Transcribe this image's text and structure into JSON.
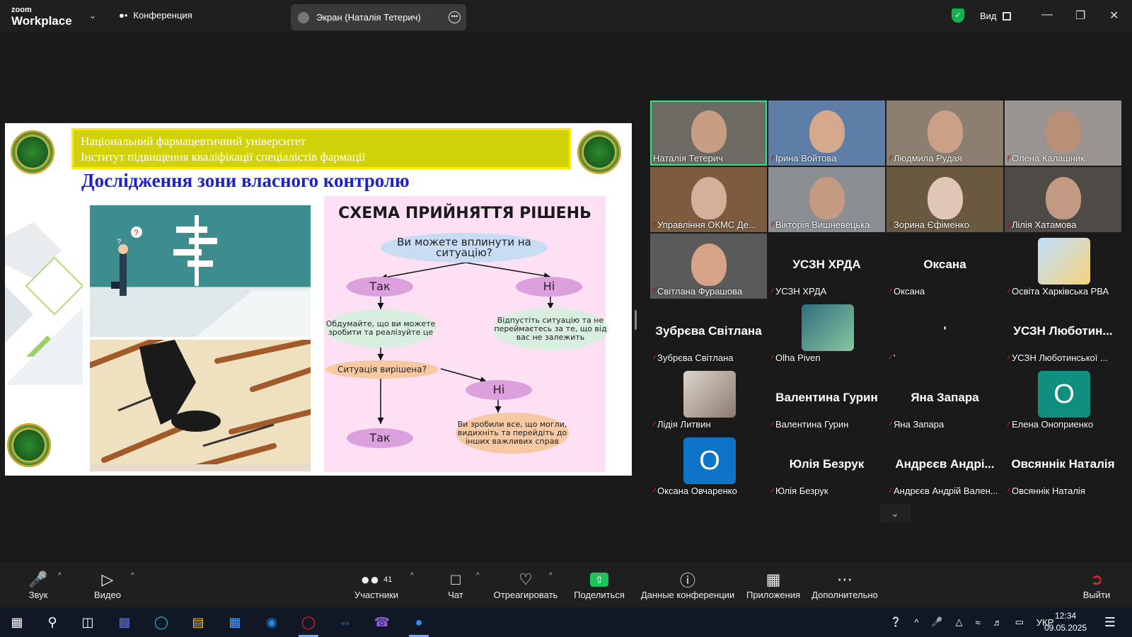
{
  "app": {
    "logo_top": "zoom",
    "logo_bottom": "Workplace",
    "conference_label": "Конференция",
    "screen_share_label": "Экран (Наталія Тетерич)",
    "view_label": "Вид"
  },
  "slide": {
    "university_line1": "Національний фармацевтичний університет",
    "university_line2": "Інститут підвищення кваліфікації спеціалістів фармації",
    "title": "Дослідження зони власного контролю",
    "diagram_title": "СХЕМА ПРИЙНЯТТЯ РІШЕНЬ",
    "nodes": {
      "question": "Ви можете вплинути на ситуацію?",
      "yes1": "Так",
      "no1": "Ні",
      "think": "Обдумайте, що ви можете зробити та реалізуйте це",
      "let_go": "Відпустіть ситуацію та не переймаєтесь за те, що від вас не залежить",
      "solved": "Ситуація вирішена?",
      "no2": "Ні",
      "done": "Ви зробили все, що могли, видихніть та перейдіть до інших важливих справ",
      "yes2": "Так"
    }
  },
  "participants": [
    {
      "name": "Наталія Тетерич",
      "kind": "video",
      "muted": false,
      "active": true,
      "big": ""
    },
    {
      "name": "Ірина Войтова",
      "kind": "video",
      "muted": true,
      "big": ""
    },
    {
      "name": "Людмила Рудая",
      "kind": "video",
      "muted": true,
      "big": ""
    },
    {
      "name": "Олена Калашник",
      "kind": "video",
      "muted": true,
      "big": ""
    },
    {
      "name": "Управління ОКМС Де...",
      "kind": "video",
      "muted": true,
      "big": ""
    },
    {
      "name": "Вікторія Вишневецька",
      "kind": "video",
      "muted": true,
      "big": ""
    },
    {
      "name": "Зорина  Єфіменко",
      "kind": "video",
      "muted": true,
      "big": ""
    },
    {
      "name": "Лілія Хатамова",
      "kind": "video",
      "muted": true,
      "big": ""
    },
    {
      "name": "Світлана Фурашова",
      "kind": "video",
      "muted": true,
      "big": ""
    },
    {
      "name": "УСЗН ХРДА",
      "kind": "name",
      "muted": true,
      "big": "УСЗН ХРДА"
    },
    {
      "name": "Оксана",
      "kind": "name",
      "muted": true,
      "big": "Оксана"
    },
    {
      "name": "Освіта Харківська РВА",
      "kind": "picture",
      "muted": true,
      "big": ""
    },
    {
      "name": "Зубрєва Світлана",
      "kind": "name",
      "muted": true,
      "big": "Зубрєва Світлана"
    },
    {
      "name": "Olha Piven",
      "kind": "picture",
      "muted": true,
      "big": ""
    },
    {
      "name": "'",
      "kind": "name",
      "muted": true,
      "big": "'"
    },
    {
      "name": "УСЗН Люботинської ...",
      "kind": "name",
      "muted": true,
      "big": "УСЗН Любо­тин..."
    },
    {
      "name": "Лідія Литвин",
      "kind": "picture",
      "muted": true,
      "big": ""
    },
    {
      "name": "Валентина Гурин",
      "kind": "name",
      "muted": true,
      "big": "Валентина Гурин"
    },
    {
      "name": "Яна Запара",
      "kind": "name",
      "muted": true,
      "big": "Яна Запара"
    },
    {
      "name": "Елена Оноприенко",
      "kind": "letter",
      "muted": true,
      "big": "О",
      "color": "#0f8f7e"
    },
    {
      "name": "Оксана Овчаренко",
      "kind": "letter",
      "muted": true,
      "big": "О",
      "color": "#0e74c8"
    },
    {
      "name": "Юлія Безрук",
      "kind": "name",
      "muted": true,
      "big": "Юлія Безрук"
    },
    {
      "name": "Андрєєв Андрій Вален...",
      "kind": "name",
      "muted": true,
      "big": "Андрєєв Андрі..."
    },
    {
      "name": "Овсяннік Наталія",
      "kind": "name",
      "muted": true,
      "big": "Овсяннік Наталія"
    }
  ],
  "toolbar": {
    "audio": "Звук",
    "video": "Видео",
    "participants": "Участники",
    "participants_count": "41",
    "chat": "Чат",
    "react": "Отреагировать",
    "share": "Поделиться",
    "info": "Данные конференции",
    "apps": "Приложения",
    "more": "Дополнительно",
    "leave": "Выйти"
  },
  "taskbar": {
    "language": "УКР",
    "time": "12:34",
    "date": "09.05.2025"
  },
  "colors": {
    "accent_green": "#2ee58c",
    "share_green": "#1fc35d",
    "mute_red": "#e02828"
  }
}
